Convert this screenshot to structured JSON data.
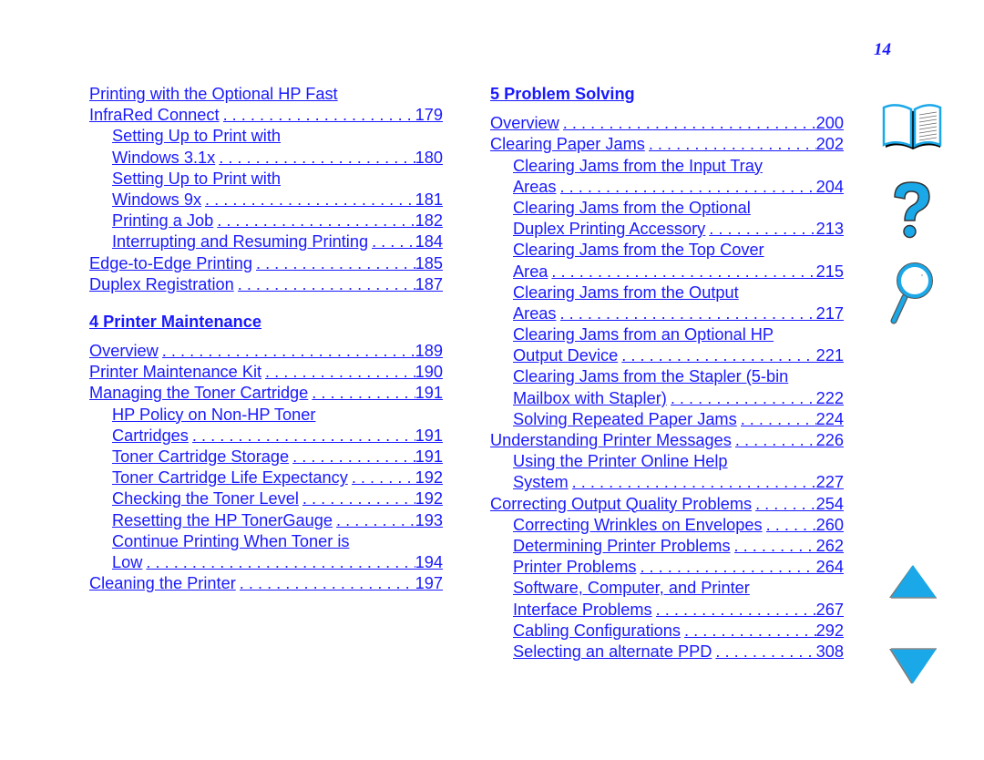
{
  "page_number": "14",
  "left_column": {
    "pre_entries": [
      {
        "lines": [
          "Printing with the Optional HP Fast",
          "InfraRed Connect"
        ],
        "page": "179",
        "indent": false
      },
      {
        "lines": [
          "Setting Up to Print with",
          "Windows 3.1x"
        ],
        "page": "180",
        "indent": true
      },
      {
        "lines": [
          "Setting Up to Print with",
          "Windows 9x"
        ],
        "page": "181",
        "indent": true
      },
      {
        "lines": [
          "Printing a Job"
        ],
        "page": "182",
        "indent": true
      },
      {
        "lines": [
          "Interrupting and Resuming Printing"
        ],
        "page": "184",
        "indent": true
      },
      {
        "lines": [
          "Edge-to-Edge Printing"
        ],
        "page": "185",
        "indent": false
      },
      {
        "lines": [
          "Duplex Registration"
        ],
        "page": "187",
        "indent": false
      }
    ],
    "section_heading": "4 Printer Maintenance",
    "entries": [
      {
        "lines": [
          "Overview"
        ],
        "page": "189",
        "indent": false
      },
      {
        "lines": [
          "Printer Maintenance Kit"
        ],
        "page": "190",
        "indent": false
      },
      {
        "lines": [
          "Managing the Toner Cartridge"
        ],
        "page": "191",
        "indent": false
      },
      {
        "lines": [
          "HP Policy on Non-HP Toner",
          "Cartridges"
        ],
        "page": "191",
        "indent": true
      },
      {
        "lines": [
          "Toner Cartridge Storage"
        ],
        "page": "191",
        "indent": true
      },
      {
        "lines": [
          "Toner Cartridge Life Expectancy"
        ],
        "page": "192",
        "indent": true
      },
      {
        "lines": [
          "Checking the Toner Level"
        ],
        "page": "192",
        "indent": true
      },
      {
        "lines": [
          "Resetting the HP TonerGauge"
        ],
        "page": "193",
        "indent": true
      },
      {
        "lines": [
          "Continue Printing When Toner is",
          "Low"
        ],
        "page": "194",
        "indent": true
      },
      {
        "lines": [
          "Cleaning the Printer"
        ],
        "page": "197",
        "indent": false
      }
    ]
  },
  "right_column": {
    "section_heading": "5 Problem Solving",
    "entries": [
      {
        "lines": [
          "Overview"
        ],
        "page": "200",
        "indent": false
      },
      {
        "lines": [
          "Clearing Paper Jams"
        ],
        "page": "202",
        "indent": false
      },
      {
        "lines": [
          "Clearing Jams from the Input Tray",
          "Areas"
        ],
        "page": "204",
        "indent": true
      },
      {
        "lines": [
          "Clearing Jams from the Optional",
          "Duplex Printing Accessory"
        ],
        "page": "213",
        "indent": true
      },
      {
        "lines": [
          "Clearing Jams from the Top Cover",
          "Area"
        ],
        "page": "215",
        "indent": true
      },
      {
        "lines": [
          "Clearing Jams from the Output",
          "Areas"
        ],
        "page": "217",
        "indent": true
      },
      {
        "lines": [
          "Clearing Jams from an Optional HP",
          "Output Device"
        ],
        "page": "221",
        "indent": true
      },
      {
        "lines": [
          "Clearing Jams from the Stapler (5-bin",
          "Mailbox with Stapler)"
        ],
        "page": "222",
        "indent": true
      },
      {
        "lines": [
          "Solving Repeated Paper Jams"
        ],
        "page": "224",
        "indent": true
      },
      {
        "lines": [
          "Understanding Printer Messages"
        ],
        "page": "226",
        "indent": false
      },
      {
        "lines": [
          "Using the Printer Online Help",
          "System"
        ],
        "page": "227",
        "indent": true
      },
      {
        "lines": [
          "Correcting Output Quality Problems"
        ],
        "page": "254",
        "indent": false
      },
      {
        "lines": [
          "Correcting Wrinkles on Envelopes"
        ],
        "page": "260",
        "indent": true
      },
      {
        "lines": [
          "Determining Printer Problems"
        ],
        "page": "262",
        "indent": true
      },
      {
        "lines": [
          "Printer Problems"
        ],
        "page": "264",
        "indent": true
      },
      {
        "lines": [
          "Software, Computer, and Printer",
          "Interface Problems"
        ],
        "page": "267",
        "indent": true
      },
      {
        "lines": [
          "Cabling Configurations"
        ],
        "page": "292",
        "indent": true
      },
      {
        "lines": [
          "Selecting an alternate PPD"
        ],
        "page": "308",
        "indent": true
      }
    ]
  },
  "nav_icons": [
    {
      "name": "contents-book-icon",
      "label": "Contents"
    },
    {
      "name": "help-question-icon",
      "label": "Help"
    },
    {
      "name": "index-magnifier-icon",
      "label": "Index"
    },
    {
      "name": "previous-page-arrow-icon",
      "label": "Previous page"
    },
    {
      "name": "next-page-arrow-icon",
      "label": "Next page"
    }
  ],
  "colors": {
    "link": "#1a1aff",
    "icon_fill": "#1aa8e8",
    "shadow": "#555555"
  }
}
